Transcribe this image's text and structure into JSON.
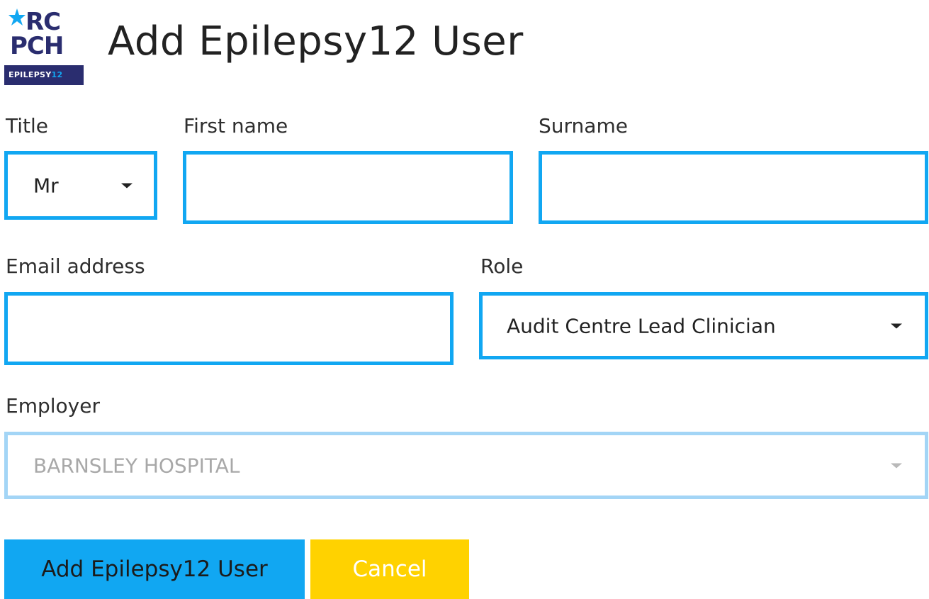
{
  "logo": {
    "line1": "RC",
    "line2": "PCH",
    "band_prefix": "EPILEPSY",
    "band_suffix": "12",
    "colors": {
      "navy": "#2a2d6f",
      "blue": "#11A7F2"
    }
  },
  "page": {
    "title": "Add Epilepsy12 User"
  },
  "form": {
    "title": {
      "label": "Title",
      "value": "Mr"
    },
    "first_name": {
      "label": "First name",
      "value": ""
    },
    "surname": {
      "label": "Surname",
      "value": ""
    },
    "email": {
      "label": "Email address",
      "value": ""
    },
    "role": {
      "label": "Role",
      "value": "Audit Centre Lead Clinician"
    },
    "employer": {
      "label": "Employer",
      "value": "BARNSLEY HOSPITAL",
      "disabled": true
    }
  },
  "actions": {
    "submit_label": "Add Epilepsy12 User",
    "cancel_label": "Cancel"
  },
  "colors": {
    "accent": "#11A7F2",
    "accent_disabled": "#a3d5f6",
    "cancel": "#FFD200"
  },
  "icons": {
    "select_caret": "chevron-down-icon",
    "logo_figure": "star-person-icon"
  }
}
